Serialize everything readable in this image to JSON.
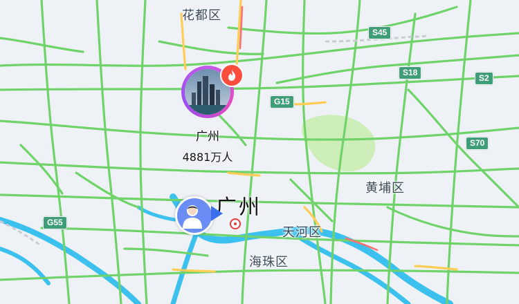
{
  "map": {
    "colors": {
      "background": "#eef2f6",
      "expressway": "#6fd36a",
      "congested": "#ffcc55",
      "water": "#3cc0ee",
      "green_area": "#cdeeb9"
    },
    "districts": [
      {
        "id": "huadu",
        "label": "花都区"
      },
      {
        "id": "huangpu",
        "label": "黄埔区"
      },
      {
        "id": "tianhe",
        "label": "天河区"
      },
      {
        "id": "haizhu",
        "label": "海珠区"
      }
    ],
    "city_label": "广州",
    "road_shields": [
      "S45",
      "S18",
      "S2",
      "G15",
      "S70",
      "G55"
    ],
    "city_pin": {
      "name": "广州",
      "population": "4881万人",
      "badge_icon": "flame-icon"
    },
    "user_location": {
      "icon": "user-avatar-icon",
      "heading_icon": "direction-arrow-icon"
    },
    "center_marker": {
      "icon": "target-icon"
    }
  }
}
